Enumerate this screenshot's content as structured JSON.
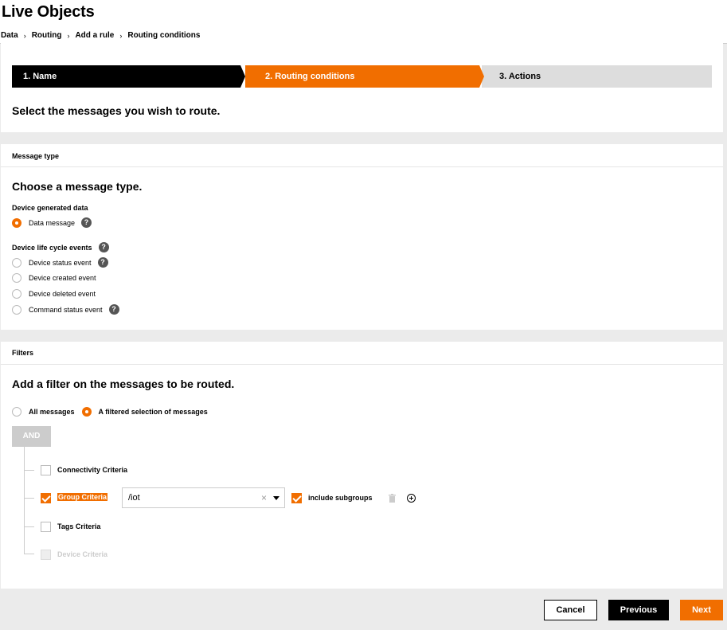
{
  "app": {
    "title": "Live Objects"
  },
  "breadcrumb": [
    "Data",
    "Routing",
    "Add a rule",
    "Routing conditions"
  ],
  "stepper": {
    "steps": [
      "1. Name",
      "2. Routing conditions",
      "3. Actions"
    ],
    "active_color": "#f16e00"
  },
  "intro": {
    "heading": "Select the messages you wish to route."
  },
  "message_type": {
    "section_label": "Message type",
    "heading": "Choose a message type.",
    "device_generated_label": "Device generated data",
    "data_message_label": "Data message",
    "lifecycle_label": "Device life cycle events",
    "options": [
      "Device status event",
      "Device created event",
      "Device deleted event",
      "Command status event"
    ]
  },
  "filters": {
    "section_label": "Filters",
    "heading": "Add a filter on the messages to be routed.",
    "all_messages_label": "All messages",
    "filtered_label": "A filtered selection of messages",
    "and_label": "AND",
    "criteria": [
      "Connectivity Criteria",
      "Group Criteria",
      "Tags Criteria",
      "Device Criteria"
    ],
    "group_value": "/iot",
    "clear_glyph": "×",
    "include_subgroups_label": "include subgroups"
  },
  "footer": {
    "cancel_label": "Cancel",
    "previous_label": "Previous",
    "next_label": "Next"
  }
}
